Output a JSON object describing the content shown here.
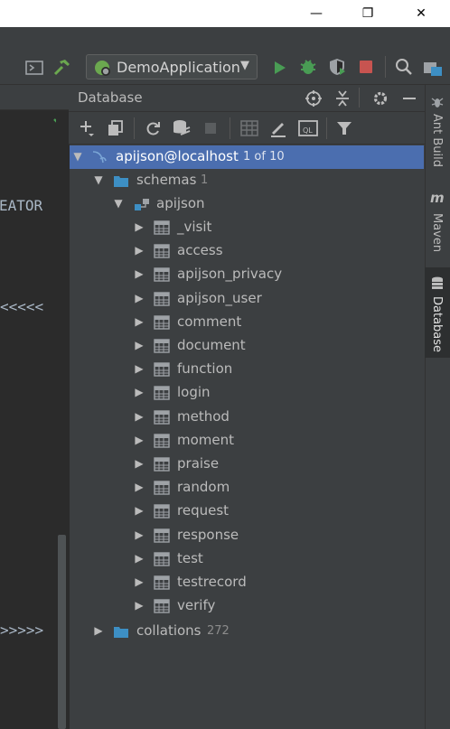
{
  "window": {
    "minimize_glyph": "—",
    "maximize_glyph": "❐",
    "close_glyph": "✕"
  },
  "toolbar": {
    "run_config_label": "DemoApplication",
    "run_config_arrow": "▼",
    "icons": [
      "terminal-icon",
      "build-hammer-icon",
      "run-icon",
      "debug-icon",
      "coverage-icon",
      "stop-icon",
      "search-icon",
      "project-structure-icon"
    ]
  },
  "editor": {
    "snippet_top": "EATOR",
    "snippet_mid": "<<<<<",
    "snippet_bot": ">>>>>"
  },
  "db_panel": {
    "title": "Database",
    "header_icons": [
      "locate-icon",
      "collapse-icon",
      "settings-icon",
      "minimize-icon"
    ],
    "toolbar_icons": [
      "add-icon",
      "copy-icon",
      "refresh-icon",
      "schema-sync-icon",
      "stop-icon",
      "table-view-icon",
      "edit-icon",
      "console-ql-icon",
      "filter-icon"
    ]
  },
  "tree": {
    "datasource": {
      "label": "apijson@localhost",
      "count": "1 of 10"
    },
    "schemas": {
      "label": "schemas",
      "count": "1"
    },
    "schema": {
      "label": "apijson"
    },
    "tables": [
      "_visit",
      "access",
      "apijson_privacy",
      "apijson_user",
      "comment",
      "document",
      "function",
      "login",
      "method",
      "moment",
      "praise",
      "random",
      "request",
      "response",
      "test",
      "testrecord",
      "verify"
    ],
    "collations": {
      "label": "collations",
      "count": "272"
    }
  },
  "right_strip": {
    "ant_build": "Ant Build",
    "maven": "Maven",
    "database": "Database"
  },
  "colors": {
    "selection": "#4b6eaf",
    "panel_bg": "#3c3f41",
    "editor_bg": "#2b2b2b",
    "folder_blue": "#3d8fc4",
    "run_green": "#499c54",
    "stop_red": "#c75450"
  }
}
